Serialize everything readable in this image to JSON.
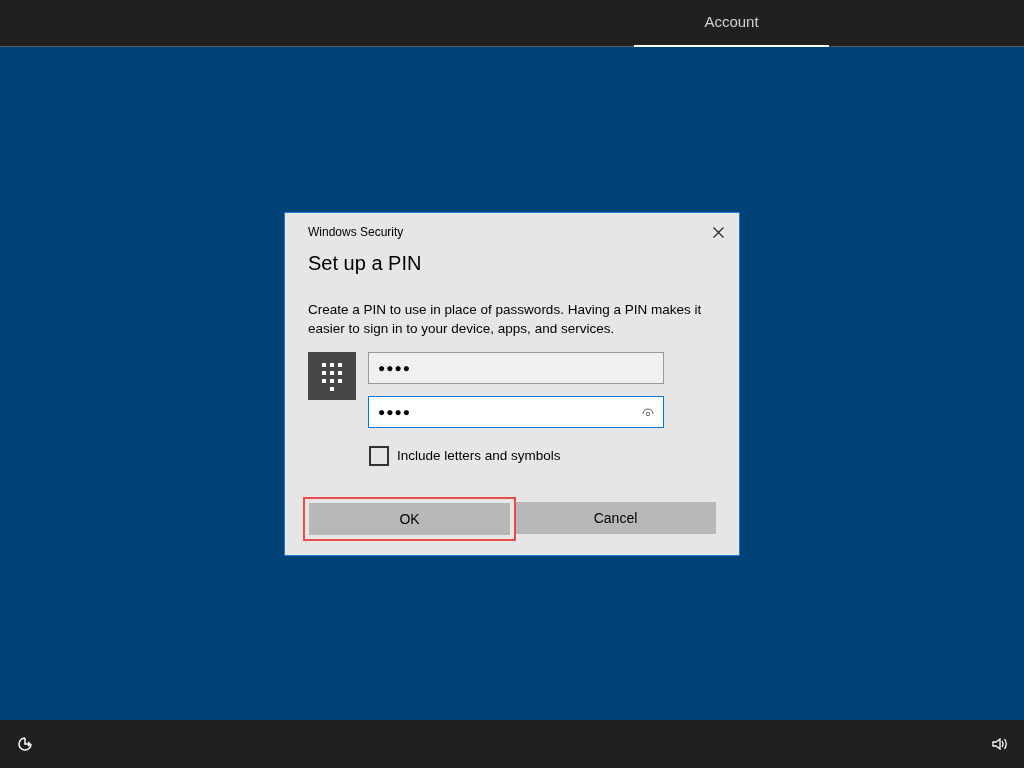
{
  "top_bar": {
    "tabs": [
      {
        "label": "Account",
        "selected": true
      }
    ]
  },
  "dialog": {
    "caption": "Windows Security",
    "title": "Set up a PIN",
    "description": "Create a PIN to use in place of passwords. Having a PIN makes it easier to sign in to your device, apps, and services.",
    "fields": [
      {
        "value": "●●●●",
        "focused": false
      },
      {
        "value": "●●●●",
        "focused": true
      }
    ],
    "checkbox": {
      "label": "Include letters and symbols",
      "checked": false
    },
    "buttons": [
      {
        "label": "OK",
        "highlighted": true
      },
      {
        "label": "Cancel",
        "highlighted": false
      }
    ]
  }
}
